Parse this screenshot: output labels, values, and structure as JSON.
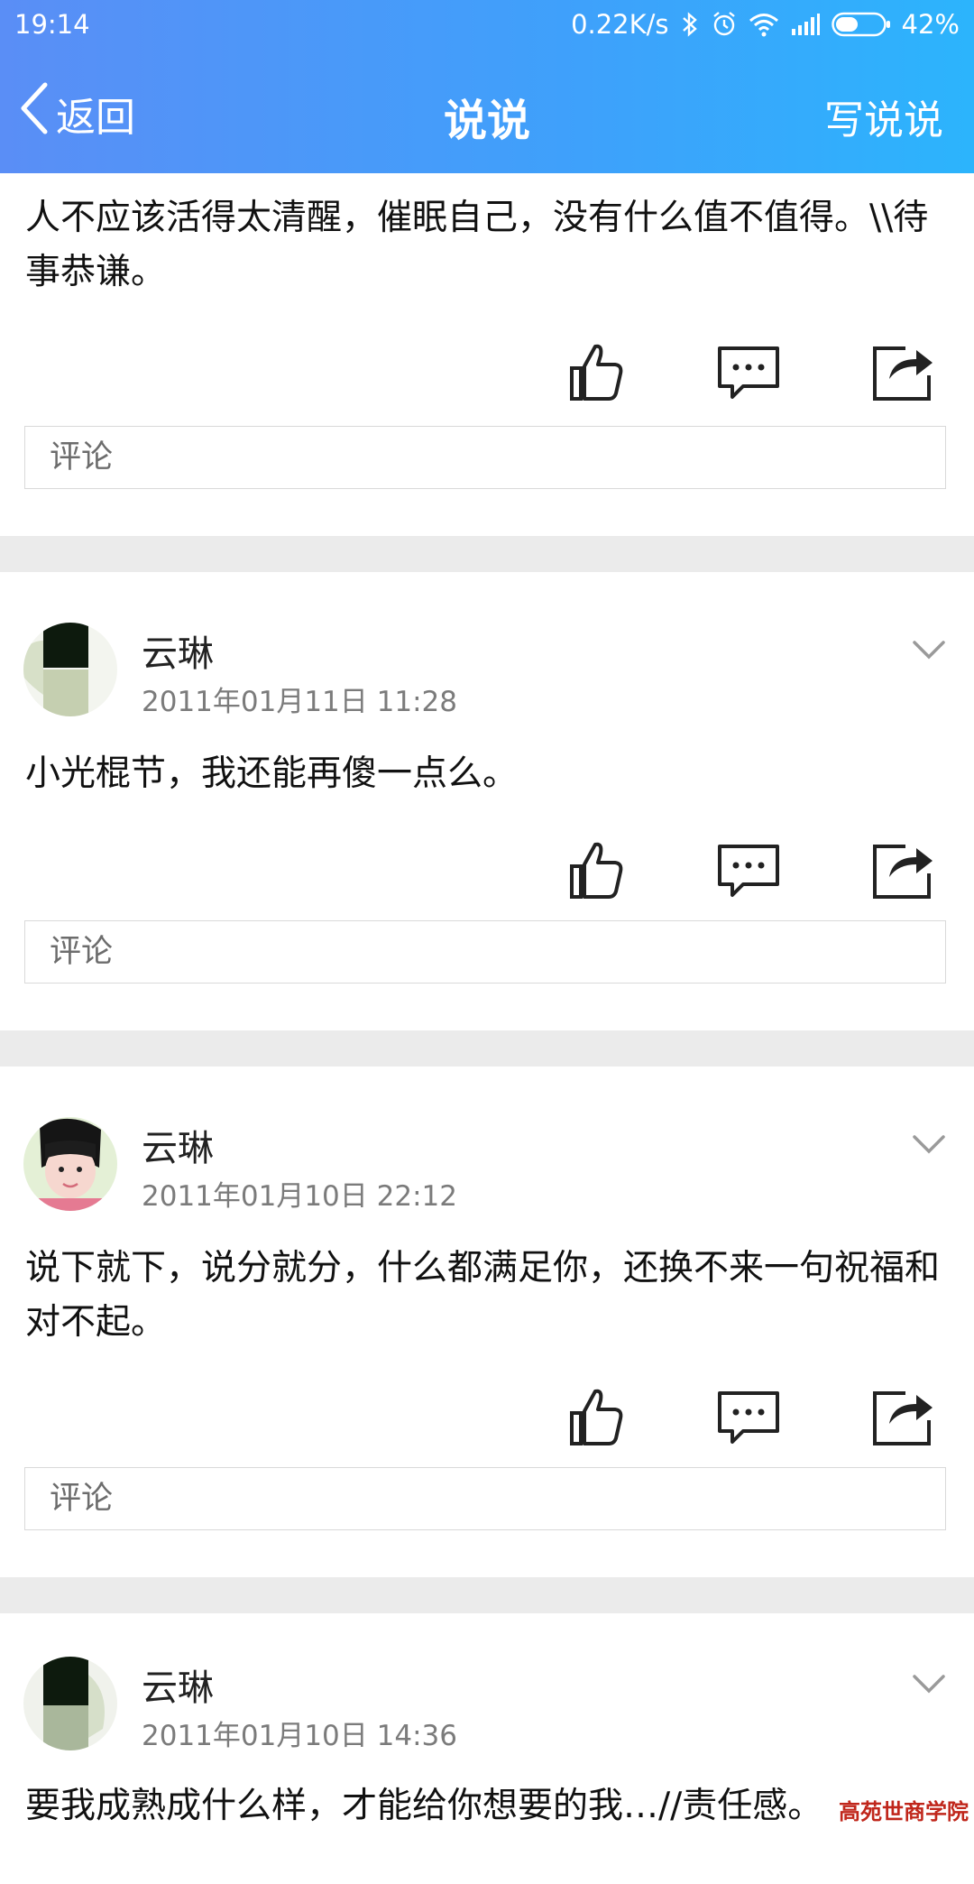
{
  "status_bar": {
    "time": "19:14",
    "speed": "0.22K/s",
    "battery": "42%"
  },
  "navbar": {
    "back_label": "返回",
    "title": "说说",
    "write_label": "写说说"
  },
  "comment_placeholder": "评论",
  "posts": [
    {
      "text": "人不应该活得太清醒，催眠自己，没有什么值不值得。\\\\待事恭谦。"
    },
    {
      "author": "云琳",
      "time": "2011年01月11日 11:28",
      "text": "小光棍节，我还能再傻一点么。"
    },
    {
      "author": "云琳",
      "time": "2011年01月10日 22:12",
      "text": "说下就下，说分就分，什么都满足你，还换不来一句祝福和对不起。"
    },
    {
      "author": "云琳",
      "time": "2011年01月10日 14:36",
      "text": "要我成熟成什么样，才能给你想要的我…//责任感。"
    }
  ],
  "watermark": "高苑世商学院",
  "colors": {
    "header_start": "#5a8ef6",
    "header_end": "#2cb4fc",
    "separator": "#ebebeb"
  },
  "icons": [
    "back-chevron-icon",
    "like-icon",
    "comment-icon",
    "share-icon",
    "chevron-down-icon",
    "bluetooth-icon",
    "alarm-icon",
    "wifi-icon",
    "signal-icon",
    "battery-icon"
  ]
}
